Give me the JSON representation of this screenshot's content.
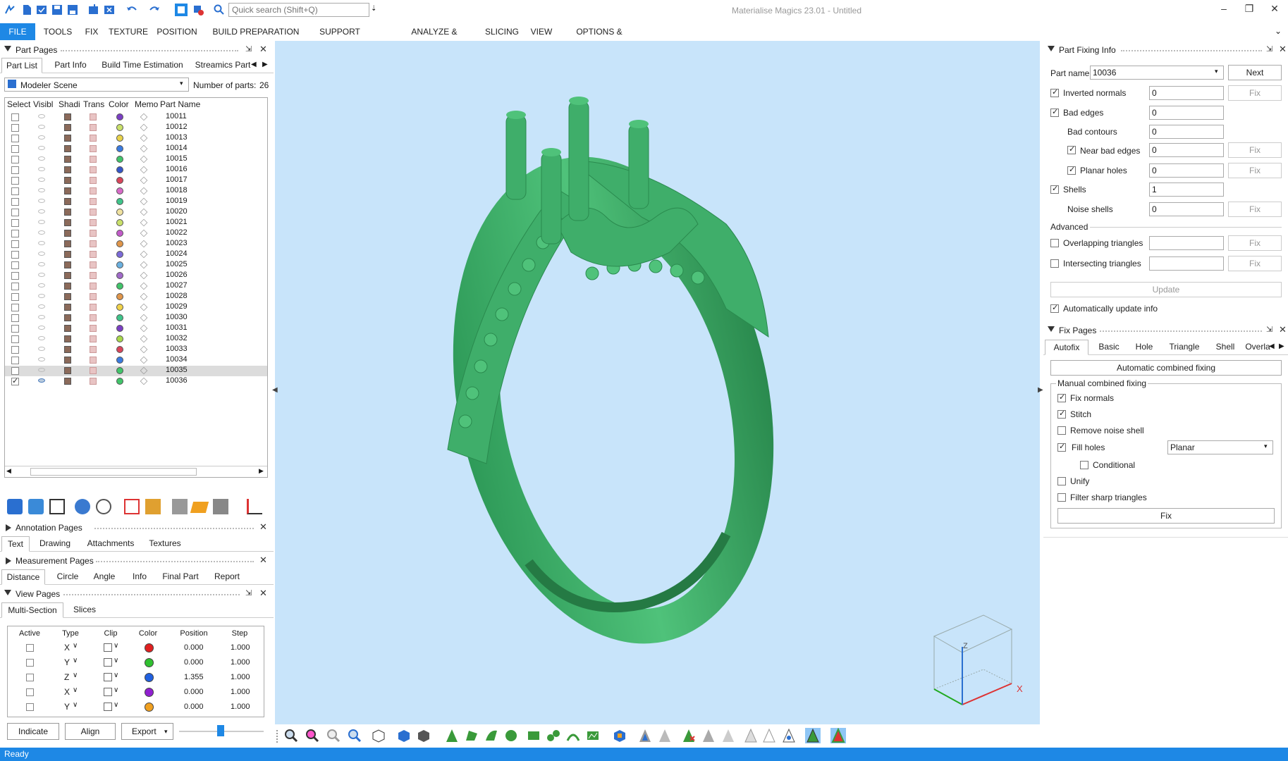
{
  "app": {
    "title": "Materialise Magics 23.01 - Untitled",
    "search_placeholder": "Quick search (Shift+Q)",
    "status": "Ready"
  },
  "menu": [
    "FILE",
    "TOOLS",
    "FIX",
    "TEXTURE",
    "POSITION",
    "BUILD PREPARATION",
    "SUPPORT GENERATION",
    "ANALYZE & REPORT",
    "SLICING",
    "VIEW",
    "OPTIONS & HELP"
  ],
  "part_pages": {
    "title": "Part Pages",
    "tabs": [
      "Part List",
      "Part Info",
      "Build Time Estimation",
      "Streamics Part"
    ],
    "scene": "Modeler Scene",
    "num_parts_label": "Number of parts:",
    "num_parts": "26",
    "columns": [
      "Select",
      "Visibl",
      "Shadi",
      "Trans",
      "Color",
      "Memo",
      "Part Name"
    ],
    "parts": [
      {
        "name": "10011",
        "color": "#7b3fc4"
      },
      {
        "name": "10012",
        "color": "#c9e06a"
      },
      {
        "name": "10013",
        "color": "#e8d24a"
      },
      {
        "name": "10014",
        "color": "#3a7be0"
      },
      {
        "name": "10015",
        "color": "#41c46a"
      },
      {
        "name": "10016",
        "color": "#3556c9"
      },
      {
        "name": "10017",
        "color": "#d9455b"
      },
      {
        "name": "10018",
        "color": "#d86ac8"
      },
      {
        "name": "10019",
        "color": "#3fc48a"
      },
      {
        "name": "10020",
        "color": "#f0e2a0"
      },
      {
        "name": "10021",
        "color": "#c9e06a"
      },
      {
        "name": "10022",
        "color": "#c25bc9"
      },
      {
        "name": "10023",
        "color": "#e0964a"
      },
      {
        "name": "10024",
        "color": "#7b6ad8"
      },
      {
        "name": "10025",
        "color": "#6ab0e0"
      },
      {
        "name": "10026",
        "color": "#a06ac9"
      },
      {
        "name": "10027",
        "color": "#41c46a"
      },
      {
        "name": "10028",
        "color": "#e0964a"
      },
      {
        "name": "10029",
        "color": "#f0d24a"
      },
      {
        "name": "10030",
        "color": "#3fc48a"
      },
      {
        "name": "10031",
        "color": "#7b3fc4"
      },
      {
        "name": "10032",
        "color": "#a8d84a"
      },
      {
        "name": "10033",
        "color": "#d9455b"
      },
      {
        "name": "10034",
        "color": "#3a7be0"
      },
      {
        "name": "10035",
        "color": "#41c46a",
        "highlight": true
      },
      {
        "name": "10036",
        "color": "#41c46a",
        "checked": true
      }
    ]
  },
  "annotation_pages": {
    "title": "Annotation Pages",
    "tabs": [
      "Text",
      "Drawing",
      "Attachments",
      "Textures"
    ]
  },
  "measurement_pages": {
    "title": "Measurement Pages",
    "tabs": [
      "Distance",
      "Circle",
      "Angle",
      "Info",
      "Final Part",
      "Report"
    ]
  },
  "view_pages": {
    "title": "View Pages",
    "tabs": [
      "Multi-Section",
      "Slices"
    ],
    "columns": [
      "Active",
      "Type",
      "Clip",
      "Color",
      "Position",
      "Step"
    ],
    "rows": [
      {
        "type": "X",
        "color": "#e02020",
        "position": "0.000",
        "step": "1.000"
      },
      {
        "type": "Y",
        "color": "#30c030",
        "position": "0.000",
        "step": "1.000"
      },
      {
        "type": "Z",
        "color": "#2060e0",
        "position": "1.355",
        "step": "1.000"
      },
      {
        "type": "X",
        "color": "#9020d0",
        "position": "0.000",
        "step": "1.000"
      },
      {
        "type": "Y",
        "color": "#f0a020",
        "position": "0.000",
        "step": "1.000"
      }
    ],
    "buttons": {
      "indicate": "Indicate",
      "align": "Align",
      "export": "Export"
    }
  },
  "part_fixing": {
    "title": "Part Fixing Info",
    "part_name_label": "Part name",
    "part_name": "10036",
    "next": "Next",
    "fix": "Fix",
    "rows": {
      "inverted_normals": {
        "label": "Inverted normals",
        "value": "0"
      },
      "bad_edges": {
        "label": "Bad edges",
        "value": "0"
      },
      "bad_contours": {
        "label": "Bad contours",
        "value": "0"
      },
      "near_bad_edges": {
        "label": "Near bad edges",
        "value": "0"
      },
      "planar_holes": {
        "label": "Planar holes",
        "value": "0"
      },
      "shells": {
        "label": "Shells",
        "value": "1"
      },
      "noise_shells": {
        "label": "Noise shells",
        "value": "0"
      }
    },
    "advanced": "Advanced",
    "overlapping": "Overlapping triangles",
    "intersecting": "Intersecting triangles",
    "update": "Update",
    "auto_update": "Automatically update info"
  },
  "fix_pages": {
    "title": "Fix Pages",
    "tabs": [
      "Autofix",
      "Basic",
      "Hole",
      "Triangle",
      "Shell",
      "Overla"
    ],
    "auto_combined": "Automatic combined fixing",
    "manual_group": "Manual combined fixing",
    "fix_normals": "Fix normals",
    "stitch": "Stitch",
    "remove_noise": "Remove noise shell",
    "fill_holes": "Fill holes",
    "fill_mode": "Planar",
    "conditional": "Conditional",
    "unify": "Unify",
    "filter_sharp": "Filter sharp triangles",
    "fix": "Fix"
  },
  "viewport": {
    "axis_z": "Z",
    "axis_x": "X"
  },
  "colors": {
    "accent": "#1e88e5",
    "viewport_bg": "#c8e4fa",
    "model": "#3fae6a"
  }
}
